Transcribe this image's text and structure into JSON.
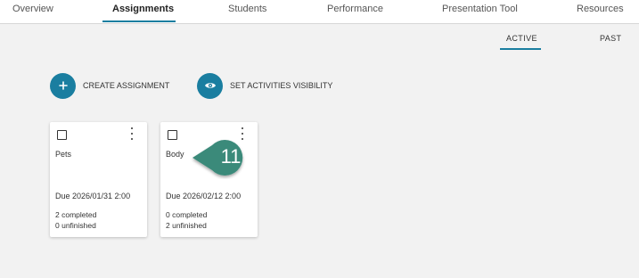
{
  "nav": {
    "tabs": [
      {
        "label": "Overview"
      },
      {
        "label": "Assignments"
      },
      {
        "label": "Students"
      },
      {
        "label": "Performance"
      },
      {
        "label": "Presentation Tool"
      },
      {
        "label": "Resources"
      }
    ],
    "active_tab": "Assignments"
  },
  "subtabs": {
    "active": "ACTIVE",
    "past": "PAST"
  },
  "actions": {
    "create_label": "CREATE ASSIGNMENT",
    "visibility_label": "SET ACTIVITIES VISIBILITY"
  },
  "cards": [
    {
      "title": "Pets",
      "due": "Due 2026/01/31 2:00",
      "completed": "2 completed",
      "unfinished": "0 unfinished"
    },
    {
      "title": "Body",
      "due": "Due 2026/02/12 2:00",
      "completed": "0 completed",
      "unfinished": "2 unfinished"
    }
  ],
  "callout": {
    "number": "11"
  },
  "colors": {
    "accent": "#1a7ea0",
    "callout": "#3a8a7a",
    "background": "#f2f2f2"
  },
  "icons": {
    "create": "plus-icon",
    "visibility": "eye-icon",
    "checkbox": "checkbox-icon",
    "menu": "more-vertical-icon"
  }
}
